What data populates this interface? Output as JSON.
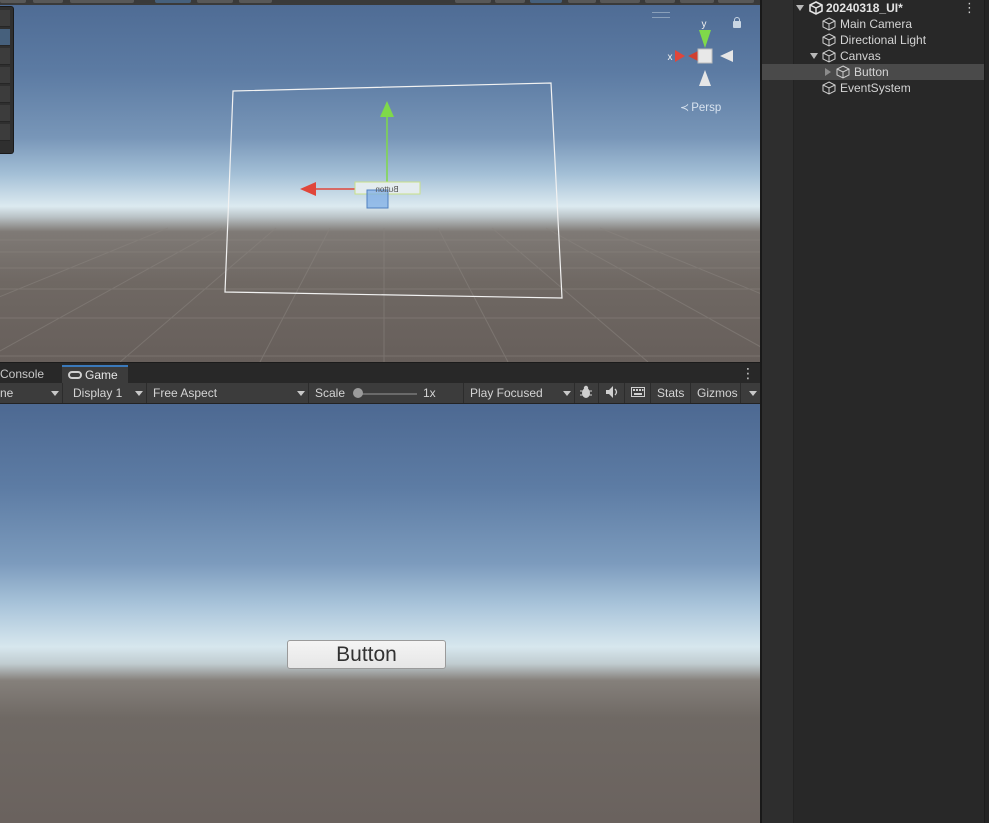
{
  "scene_view": {
    "persp_label": "Persp",
    "gizmo_axes": {
      "x": "x",
      "y": "y"
    },
    "selected_object_label": "Button"
  },
  "game_panel": {
    "tabs": [
      {
        "label": "Console"
      },
      {
        "label": "Game"
      }
    ],
    "toolbar": {
      "camera_partial": "ne",
      "display": "Display 1",
      "aspect": "Free Aspect",
      "scale_label": "Scale",
      "scale_value": "1x",
      "play_mode": "Play Focused",
      "stats": "Stats",
      "gizmos": "Gizmos"
    },
    "button_text": "Button"
  },
  "hierarchy": {
    "scene_name": "20240318_UI*",
    "items": [
      {
        "label": "Main Camera"
      },
      {
        "label": "Directional Light"
      },
      {
        "label": "Canvas"
      },
      {
        "label": "Button"
      },
      {
        "label": "EventSystem"
      }
    ]
  },
  "colors": {
    "accent_tab": "#3a79bb",
    "axis_x": "#e0463a",
    "axis_y": "#7fd94a",
    "selected_row": "#4a4a4a"
  }
}
